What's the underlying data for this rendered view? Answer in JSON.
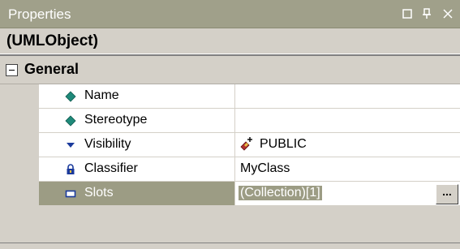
{
  "window": {
    "title": "Properties",
    "buttons": [
      {
        "name": "float",
        "icon": "window-float-icon"
      },
      {
        "name": "pin",
        "icon": "pin-icon"
      },
      {
        "name": "close",
        "icon": "close-icon"
      }
    ]
  },
  "object": {
    "name": "(UMLObject)"
  },
  "category": {
    "label": "General",
    "expanded": true
  },
  "properties": [
    {
      "name": "Name",
      "value": "",
      "icon": "diamond-icon"
    },
    {
      "name": "Stereotype",
      "value": "",
      "icon": "diamond-icon"
    },
    {
      "name": "Visibility",
      "value": "PUBLIC",
      "icon": "dropdown-triangle-icon",
      "value_icon": "public-visibility-icon"
    },
    {
      "name": "Classifier",
      "value": "MyClass",
      "icon": "lock-icon"
    },
    {
      "name": "Slots",
      "value": "(Collection)[1]",
      "icon": "collection-icon",
      "selected": true,
      "button": "..."
    }
  ],
  "colors": {
    "titlebar": "#a0a08a",
    "selection": "#9c9c84",
    "panel": "#d4d0c8",
    "diamond": "#1f8a7a",
    "triangle": "#1a3a9c",
    "lock": "#1a3a9c"
  }
}
